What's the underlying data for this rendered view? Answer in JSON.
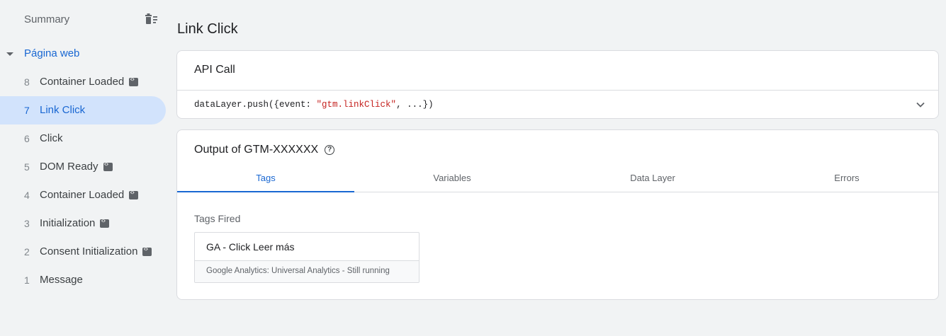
{
  "sidebar": {
    "summary_label": "Summary",
    "section_label": "Página web",
    "events": [
      {
        "num": "8",
        "label": "Container Loaded",
        "badge": true,
        "active": false
      },
      {
        "num": "7",
        "label": "Link Click",
        "badge": false,
        "active": true
      },
      {
        "num": "6",
        "label": "Click",
        "badge": false,
        "active": false
      },
      {
        "num": "5",
        "label": "DOM Ready",
        "badge": true,
        "active": false
      },
      {
        "num": "4",
        "label": "Container Loaded",
        "badge": true,
        "active": false
      },
      {
        "num": "3",
        "label": "Initialization",
        "badge": true,
        "active": false
      },
      {
        "num": "2",
        "label": "Consent Initialization",
        "badge": true,
        "active": false
      },
      {
        "num": "1",
        "label": "Message",
        "badge": false,
        "active": false
      }
    ]
  },
  "main": {
    "title": "Link Click",
    "api_call": {
      "title": "API Call",
      "code_prefix": "dataLayer.push({event: ",
      "code_string": "\"gtm.linkClick\"",
      "code_suffix": ", ...})"
    },
    "output": {
      "title": "Output of GTM-XXXXXX",
      "tabs": [
        "Tags",
        "Variables",
        "Data Layer",
        "Errors"
      ],
      "active_tab": "Tags",
      "tags_fired_label": "Tags Fired",
      "tag": {
        "name": "GA - Click Leer más",
        "status": "Google Analytics: Universal Analytics - Still running"
      }
    }
  },
  "colors": {
    "accent": "#1967d2",
    "active_bg": "#d2e3fc",
    "background": "#f1f3f4",
    "code_string": "#c5221f"
  }
}
